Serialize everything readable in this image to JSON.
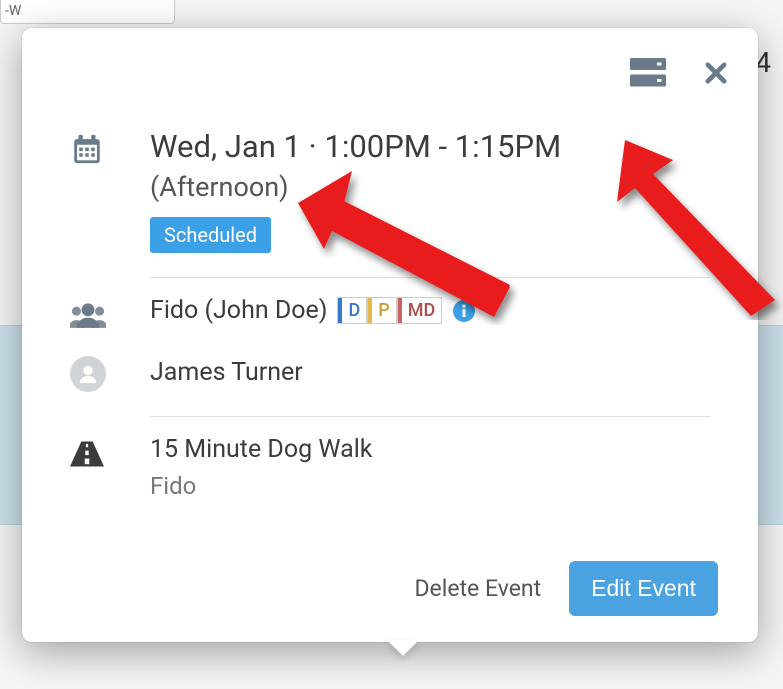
{
  "bg": {
    "tab_fragment": "-W",
    "corner_number": "4"
  },
  "header": {
    "date_time": "Wed, Jan 1 · 1:00PM - 1:15PM",
    "period": "(Afternoon)",
    "status": "Scheduled"
  },
  "client": {
    "display": "Fido (John Doe)",
    "tags": {
      "d": "D",
      "p": "P",
      "md": "MD"
    }
  },
  "staff": {
    "name": "James Turner"
  },
  "service": {
    "title": "15 Minute Dog Walk",
    "subject": "Fido"
  },
  "actions": {
    "delete": "Delete Event",
    "edit": "Edit Event"
  }
}
